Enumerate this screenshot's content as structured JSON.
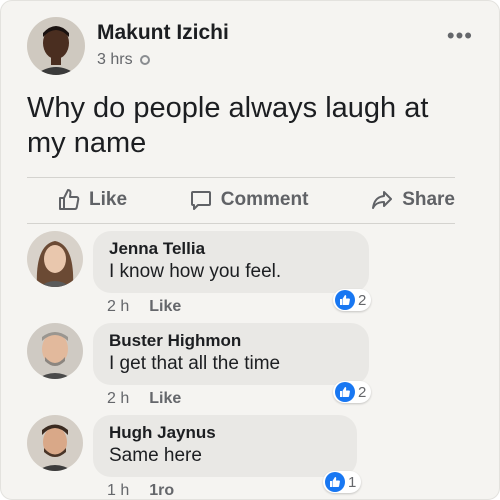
{
  "post": {
    "author": "Makunt Izichi",
    "time": "3 hrs",
    "text": "Why do people always laugh at my name",
    "more_label": "•••"
  },
  "actions": {
    "like": "Like",
    "comment": "Comment",
    "share": "Share"
  },
  "comments": [
    {
      "name": "Jenna Tellia",
      "text": "I know how you feel.",
      "time": "2 h",
      "like_label": "Like",
      "reactions": "2"
    },
    {
      "name": "Buster Highmon",
      "text": "I get that all the time",
      "time": "2 h",
      "like_label": "Like",
      "reactions": "2"
    },
    {
      "name": "Hugh Jaynus",
      "text": "Same here",
      "time": "1 h",
      "like_label": "1ro",
      "reactions": "1"
    }
  ],
  "colors": {
    "accent": "#1877f2",
    "background": "#f5f4f1",
    "bubble": "#e9e8e5"
  }
}
